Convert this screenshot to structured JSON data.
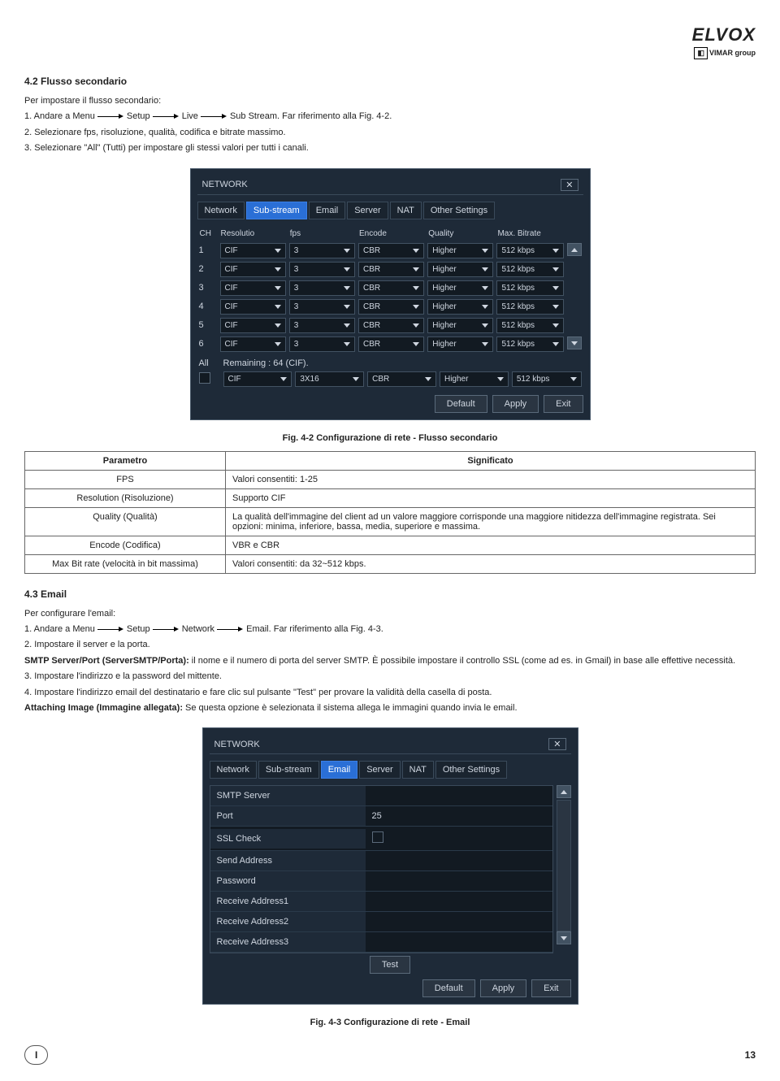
{
  "brand": {
    "main": "ELVOX",
    "sub_box": "□",
    "sub_text": "VIMAR group"
  },
  "sec42": {
    "heading": "4.2  Flusso secondario",
    "intro": "Per impostare il flusso secondario:",
    "step1_a": "1. Andare a Menu",
    "step1_b": "Setup",
    "step1_c": "Live",
    "step1_d": "Sub Stream. Far riferimento alla Fig. 4-2.",
    "step2": "2. Selezionare fps, risoluzione, qualità, codifica e bitrate massimo.",
    "step3": "3. Selezionare \"All\" (Tutti) per impostare gli stessi valori per tutti i canali."
  },
  "dvr1": {
    "title": "NETWORK",
    "tabs": [
      "Network",
      "Sub-stream",
      "Email",
      "Server",
      "NAT",
      "Other Settings"
    ],
    "active_tab_index": 1,
    "headers": [
      "CH",
      "Resolutio",
      "fps",
      "Encode",
      "Quality",
      "Max. Bitrate"
    ],
    "rows": [
      {
        "ch": "1",
        "res": "CIF",
        "fps": "3",
        "enc": "CBR",
        "q": "Higher",
        "br": "512 kbps"
      },
      {
        "ch": "2",
        "res": "CIF",
        "fps": "3",
        "enc": "CBR",
        "q": "Higher",
        "br": "512 kbps"
      },
      {
        "ch": "3",
        "res": "CIF",
        "fps": "3",
        "enc": "CBR",
        "q": "Higher",
        "br": "512 kbps"
      },
      {
        "ch": "4",
        "res": "CIF",
        "fps": "3",
        "enc": "CBR",
        "q": "Higher",
        "br": "512 kbps"
      },
      {
        "ch": "5",
        "res": "CIF",
        "fps": "3",
        "enc": "CBR",
        "q": "Higher",
        "br": "512 kbps"
      },
      {
        "ch": "6",
        "res": "CIF",
        "fps": "3",
        "enc": "CBR",
        "q": "Higher",
        "br": "512 kbps"
      }
    ],
    "all_label": "All",
    "remaining": "Remaining : 64 (CIF).",
    "all_row": {
      "res": "CIF",
      "fps": "3X16",
      "enc": "CBR",
      "q": "Higher",
      "br": "512 kbps"
    },
    "btns": [
      "Default",
      "Apply",
      "Exit"
    ]
  },
  "caption1": "Fig. 4-2 Configurazione di rete - Flusso secondario",
  "params": {
    "head_p": "Parametro",
    "head_s": "Significato",
    "rows": [
      {
        "p": "FPS",
        "s": "Valori consentiti: 1-25"
      },
      {
        "p": "Resolution (Risoluzione)",
        "s": "Supporto CIF"
      },
      {
        "p": "Quality (Qualità)",
        "s": "La qualità dell'immagine del client ad un valore maggiore corrisponde una maggiore nitidezza dell'immagine registrata. Sei opzioni: minima, inferiore, bassa, media, superiore e massima."
      },
      {
        "p": "Encode (Codifica)",
        "s": "VBR e CBR"
      },
      {
        "p": "Max Bit rate (velocità in bit massima)",
        "s": "Valori consentiti: da 32~512 kbps."
      }
    ]
  },
  "sec43": {
    "heading": "4.3  Email",
    "intro": "Per configurare l'email:",
    "step1_a": "1. Andare a Menu",
    "step1_b": "Setup",
    "step1_c": "Network",
    "step1_d": "Email. Far riferimento alla Fig. 4-3.",
    "step2": "2. Impostare il server  e la porta.",
    "para_smtp_b": "SMTP Server/Port (ServerSMTP/Porta):",
    "para_smtp_t": " il nome e il numero di porta del server SMTP. È possibile impostare il controllo SSL (come ad es. in Gmail) in base alle effettive necessità.",
    "step3": "3. Impostare l'indirizzo e la password del mittente.",
    "step4": "4. Impostare l'indirizzo email del destinatario e fare clic sul pulsante \"Test\" per provare la validità della casella di posta.",
    "attach_b": "Attaching Image (Immagine allegata):",
    "attach_t": " Se questa opzione è selezionata il sistema allega le immagini quando invia le email."
  },
  "dvr2": {
    "title": "NETWORK",
    "tabs": [
      "Network",
      "Sub-stream",
      "Email",
      "Server",
      "NAT",
      "Other Settings"
    ],
    "active_tab_index": 2,
    "fields": [
      {
        "label": "SMTP Server",
        "value": ""
      },
      {
        "label": "Port",
        "value": "25"
      },
      {
        "label": "SSL Check",
        "value": "__check__"
      },
      {
        "label": "Send Address",
        "value": ""
      },
      {
        "label": "Password",
        "value": ""
      },
      {
        "label": "Receive Address1",
        "value": ""
      },
      {
        "label": "Receive Address2",
        "value": ""
      },
      {
        "label": "Receive Address3",
        "value": ""
      }
    ],
    "test": "Test",
    "btns": [
      "Default",
      "Apply",
      "Exit"
    ]
  },
  "caption2": "Fig. 4-3 Configurazione di rete - Email",
  "footer": {
    "lang": "I",
    "page": "13"
  }
}
